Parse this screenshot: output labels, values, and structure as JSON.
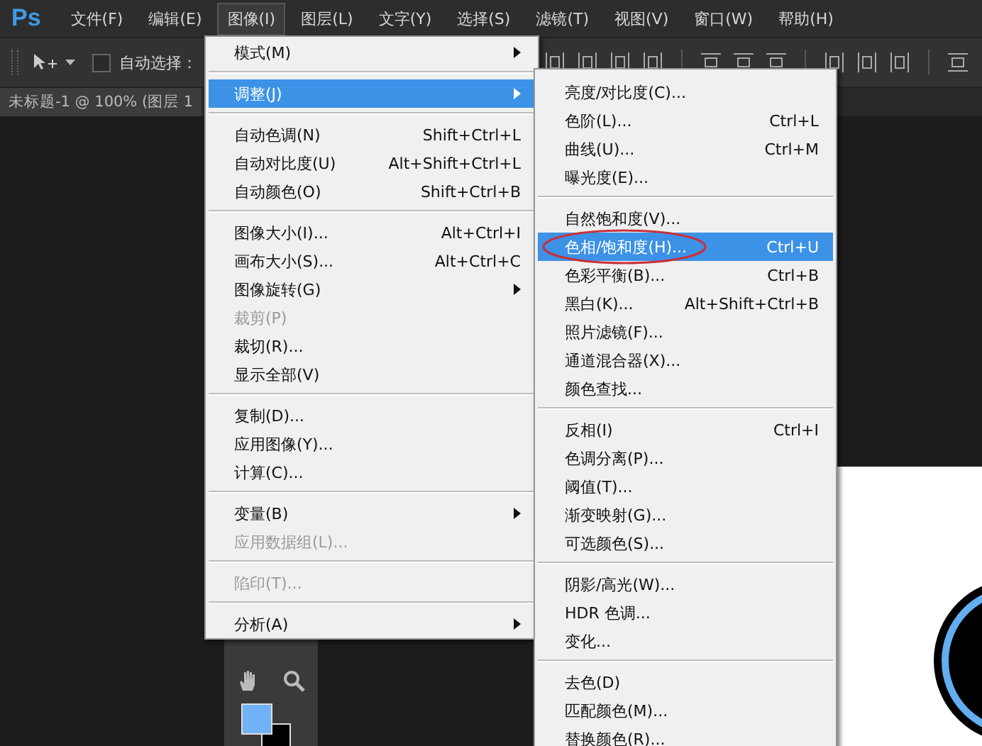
{
  "app": {
    "logo": "Ps"
  },
  "menubar": [
    {
      "label": "文件(F)",
      "selected": false
    },
    {
      "label": "编辑(E)",
      "selected": false
    },
    {
      "label": "图像(I)",
      "selected": true
    },
    {
      "label": "图层(L)",
      "selected": false
    },
    {
      "label": "文字(Y)",
      "selected": false
    },
    {
      "label": "选择(S)",
      "selected": false
    },
    {
      "label": "滤镜(T)",
      "selected": false
    },
    {
      "label": "视图(V)",
      "selected": false
    },
    {
      "label": "窗口(W)",
      "selected": false
    },
    {
      "label": "帮助(H)",
      "selected": false
    }
  ],
  "options_bar": {
    "auto_select": {
      "label": "自动选择：",
      "checked": false
    }
  },
  "document_tab": {
    "title": "未标题-1 @ 100% (图层 1"
  },
  "image_menu": {
    "items": [
      {
        "kind": "item",
        "label": "模式(M)",
        "submenu": true,
        "disabled": false,
        "selected": false
      },
      {
        "kind": "separator"
      },
      {
        "kind": "item",
        "label": "调整(J)",
        "submenu": true,
        "disabled": false,
        "selected": true
      },
      {
        "kind": "separator"
      },
      {
        "kind": "item",
        "label": "自动色调(N)",
        "shortcut": "Shift+Ctrl+L",
        "submenu": false,
        "disabled": false,
        "selected": false
      },
      {
        "kind": "item",
        "label": "自动对比度(U)",
        "shortcut": "Alt+Shift+Ctrl+L",
        "submenu": false,
        "disabled": false,
        "selected": false
      },
      {
        "kind": "item",
        "label": "自动颜色(O)",
        "shortcut": "Shift+Ctrl+B",
        "submenu": false,
        "disabled": false,
        "selected": false
      },
      {
        "kind": "separator"
      },
      {
        "kind": "item",
        "label": "图像大小(I)...",
        "shortcut": "Alt+Ctrl+I",
        "submenu": false,
        "disabled": false,
        "selected": false
      },
      {
        "kind": "item",
        "label": "画布大小(S)...",
        "shortcut": "Alt+Ctrl+C",
        "submenu": false,
        "disabled": false,
        "selected": false
      },
      {
        "kind": "item",
        "label": "图像旋转(G)",
        "submenu": true,
        "disabled": false,
        "selected": false
      },
      {
        "kind": "item",
        "label": "裁剪(P)",
        "submenu": false,
        "disabled": true,
        "selected": false
      },
      {
        "kind": "item",
        "label": "裁切(R)...",
        "submenu": false,
        "disabled": false,
        "selected": false
      },
      {
        "kind": "item",
        "label": "显示全部(V)",
        "submenu": false,
        "disabled": false,
        "selected": false
      },
      {
        "kind": "separator"
      },
      {
        "kind": "item",
        "label": "复制(D)...",
        "submenu": false,
        "disabled": false,
        "selected": false
      },
      {
        "kind": "item",
        "label": "应用图像(Y)...",
        "submenu": false,
        "disabled": false,
        "selected": false
      },
      {
        "kind": "item",
        "label": "计算(C)...",
        "submenu": false,
        "disabled": false,
        "selected": false
      },
      {
        "kind": "separator"
      },
      {
        "kind": "item",
        "label": "变量(B)",
        "submenu": true,
        "disabled": false,
        "selected": false
      },
      {
        "kind": "item",
        "label": "应用数据组(L)...",
        "submenu": false,
        "disabled": true,
        "selected": false
      },
      {
        "kind": "separator"
      },
      {
        "kind": "item",
        "label": "陷印(T)...",
        "submenu": false,
        "disabled": true,
        "selected": false
      },
      {
        "kind": "separator"
      },
      {
        "kind": "item",
        "label": "分析(A)",
        "submenu": true,
        "disabled": false,
        "selected": false
      }
    ]
  },
  "adjustments_submenu": {
    "items": [
      {
        "kind": "item",
        "label": "亮度/对比度(C)...",
        "submenu": false,
        "disabled": false,
        "selected": false
      },
      {
        "kind": "item",
        "label": "色阶(L)...",
        "shortcut": "Ctrl+L",
        "submenu": false,
        "disabled": false,
        "selected": false
      },
      {
        "kind": "item",
        "label": "曲线(U)...",
        "shortcut": "Ctrl+M",
        "submenu": false,
        "disabled": false,
        "selected": false
      },
      {
        "kind": "item",
        "label": "曝光度(E)...",
        "submenu": false,
        "disabled": false,
        "selected": false
      },
      {
        "kind": "separator"
      },
      {
        "kind": "item",
        "label": "自然饱和度(V)...",
        "submenu": false,
        "disabled": false,
        "selected": false
      },
      {
        "kind": "item",
        "label": "色相/饱和度(H)...",
        "shortcut": "Ctrl+U",
        "submenu": false,
        "disabled": false,
        "selected": true,
        "circled": true
      },
      {
        "kind": "item",
        "label": "色彩平衡(B)...",
        "shortcut": "Ctrl+B",
        "submenu": false,
        "disabled": false,
        "selected": false
      },
      {
        "kind": "item",
        "label": "黑白(K)...",
        "shortcut": "Alt+Shift+Ctrl+B",
        "submenu": false,
        "disabled": false,
        "selected": false
      },
      {
        "kind": "item",
        "label": "照片滤镜(F)...",
        "submenu": false,
        "disabled": false,
        "selected": false
      },
      {
        "kind": "item",
        "label": "通道混合器(X)...",
        "submenu": false,
        "disabled": false,
        "selected": false
      },
      {
        "kind": "item",
        "label": "颜色查找...",
        "submenu": false,
        "disabled": false,
        "selected": false
      },
      {
        "kind": "separator"
      },
      {
        "kind": "item",
        "label": "反相(I)",
        "shortcut": "Ctrl+I",
        "submenu": false,
        "disabled": false,
        "selected": false
      },
      {
        "kind": "item",
        "label": "色调分离(P)...",
        "submenu": false,
        "disabled": false,
        "selected": false
      },
      {
        "kind": "item",
        "label": "阈值(T)...",
        "submenu": false,
        "disabled": false,
        "selected": false
      },
      {
        "kind": "item",
        "label": "渐变映射(G)...",
        "submenu": false,
        "disabled": false,
        "selected": false
      },
      {
        "kind": "item",
        "label": "可选颜色(S)...",
        "submenu": false,
        "disabled": false,
        "selected": false
      },
      {
        "kind": "separator"
      },
      {
        "kind": "item",
        "label": "阴影/高光(W)...",
        "submenu": false,
        "disabled": false,
        "selected": false
      },
      {
        "kind": "item",
        "label": "HDR 色调...",
        "submenu": false,
        "disabled": false,
        "selected": false
      },
      {
        "kind": "item",
        "label": "变化...",
        "submenu": false,
        "disabled": false,
        "selected": false
      },
      {
        "kind": "separator"
      },
      {
        "kind": "item",
        "label": "去色(D)",
        "submenu": false,
        "disabled": false,
        "selected": false
      },
      {
        "kind": "item",
        "label": "匹配颜色(M)...",
        "submenu": false,
        "disabled": false,
        "selected": false
      },
      {
        "kind": "item",
        "label": "替换颜色(R)...",
        "submenu": false,
        "disabled": false,
        "selected": false
      }
    ]
  }
}
